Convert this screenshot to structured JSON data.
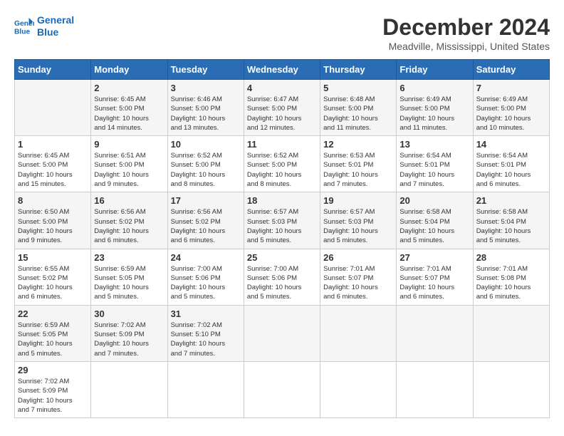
{
  "header": {
    "logo_line1": "General",
    "logo_line2": "Blue",
    "month_title": "December 2024",
    "location": "Meadville, Mississippi, United States"
  },
  "calendar": {
    "days_of_week": [
      "Sunday",
      "Monday",
      "Tuesday",
      "Wednesday",
      "Thursday",
      "Friday",
      "Saturday"
    ],
    "weeks": [
      [
        {
          "day": "",
          "info": ""
        },
        {
          "day": "2",
          "info": "Sunrise: 6:45 AM\nSunset: 5:00 PM\nDaylight: 10 hours\nand 14 minutes."
        },
        {
          "day": "3",
          "info": "Sunrise: 6:46 AM\nSunset: 5:00 PM\nDaylight: 10 hours\nand 13 minutes."
        },
        {
          "day": "4",
          "info": "Sunrise: 6:47 AM\nSunset: 5:00 PM\nDaylight: 10 hours\nand 12 minutes."
        },
        {
          "day": "5",
          "info": "Sunrise: 6:48 AM\nSunset: 5:00 PM\nDaylight: 10 hours\nand 11 minutes."
        },
        {
          "day": "6",
          "info": "Sunrise: 6:49 AM\nSunset: 5:00 PM\nDaylight: 10 hours\nand 11 minutes."
        },
        {
          "day": "7",
          "info": "Sunrise: 6:49 AM\nSunset: 5:00 PM\nDaylight: 10 hours\nand 10 minutes."
        }
      ],
      [
        {
          "day": "1",
          "info": "Sunrise: 6:45 AM\nSunset: 5:00 PM\nDaylight: 10 hours\nand 15 minutes."
        },
        {
          "day": "9",
          "info": "Sunrise: 6:51 AM\nSunset: 5:00 PM\nDaylight: 10 hours\nand 9 minutes."
        },
        {
          "day": "10",
          "info": "Sunrise: 6:52 AM\nSunset: 5:00 PM\nDaylight: 10 hours\nand 8 minutes."
        },
        {
          "day": "11",
          "info": "Sunrise: 6:52 AM\nSunset: 5:00 PM\nDaylight: 10 hours\nand 8 minutes."
        },
        {
          "day": "12",
          "info": "Sunrise: 6:53 AM\nSunset: 5:01 PM\nDaylight: 10 hours\nand 7 minutes."
        },
        {
          "day": "13",
          "info": "Sunrise: 6:54 AM\nSunset: 5:01 PM\nDaylight: 10 hours\nand 7 minutes."
        },
        {
          "day": "14",
          "info": "Sunrise: 6:54 AM\nSunset: 5:01 PM\nDaylight: 10 hours\nand 6 minutes."
        }
      ],
      [
        {
          "day": "8",
          "info": "Sunrise: 6:50 AM\nSunset: 5:00 PM\nDaylight: 10 hours\nand 9 minutes."
        },
        {
          "day": "16",
          "info": "Sunrise: 6:56 AM\nSunset: 5:02 PM\nDaylight: 10 hours\nand 6 minutes."
        },
        {
          "day": "17",
          "info": "Sunrise: 6:56 AM\nSunset: 5:02 PM\nDaylight: 10 hours\nand 6 minutes."
        },
        {
          "day": "18",
          "info": "Sunrise: 6:57 AM\nSunset: 5:03 PM\nDaylight: 10 hours\nand 5 minutes."
        },
        {
          "day": "19",
          "info": "Sunrise: 6:57 AM\nSunset: 5:03 PM\nDaylight: 10 hours\nand 5 minutes."
        },
        {
          "day": "20",
          "info": "Sunrise: 6:58 AM\nSunset: 5:04 PM\nDaylight: 10 hours\nand 5 minutes."
        },
        {
          "day": "21",
          "info": "Sunrise: 6:58 AM\nSunset: 5:04 PM\nDaylight: 10 hours\nand 5 minutes."
        }
      ],
      [
        {
          "day": "15",
          "info": "Sunrise: 6:55 AM\nSunset: 5:02 PM\nDaylight: 10 hours\nand 6 minutes."
        },
        {
          "day": "23",
          "info": "Sunrise: 6:59 AM\nSunset: 5:05 PM\nDaylight: 10 hours\nand 5 minutes."
        },
        {
          "day": "24",
          "info": "Sunrise: 7:00 AM\nSunset: 5:06 PM\nDaylight: 10 hours\nand 5 minutes."
        },
        {
          "day": "25",
          "info": "Sunrise: 7:00 AM\nSunset: 5:06 PM\nDaylight: 10 hours\nand 5 minutes."
        },
        {
          "day": "26",
          "info": "Sunrise: 7:01 AM\nSunset: 5:07 PM\nDaylight: 10 hours\nand 6 minutes."
        },
        {
          "day": "27",
          "info": "Sunrise: 7:01 AM\nSunset: 5:07 PM\nDaylight: 10 hours\nand 6 minutes."
        },
        {
          "day": "28",
          "info": "Sunrise: 7:01 AM\nSunset: 5:08 PM\nDaylight: 10 hours\nand 6 minutes."
        }
      ],
      [
        {
          "day": "22",
          "info": "Sunrise: 6:59 AM\nSunset: 5:05 PM\nDaylight: 10 hours\nand 5 minutes."
        },
        {
          "day": "30",
          "info": "Sunrise: 7:02 AM\nSunset: 5:09 PM\nDaylight: 10 hours\nand 7 minutes."
        },
        {
          "day": "31",
          "info": "Sunrise: 7:02 AM\nSunset: 5:10 PM\nDaylight: 10 hours\nand 7 minutes."
        },
        {
          "day": "",
          "info": ""
        },
        {
          "day": "",
          "info": ""
        },
        {
          "day": "",
          "info": ""
        },
        {
          "day": "",
          "info": ""
        }
      ],
      [
        {
          "day": "29",
          "info": "Sunrise: 7:02 AM\nSunset: 5:09 PM\nDaylight: 10 hours\nand 7 minutes."
        },
        {
          "day": "",
          "info": ""
        },
        {
          "day": "",
          "info": ""
        },
        {
          "day": "",
          "info": ""
        },
        {
          "day": "",
          "info": ""
        },
        {
          "day": "",
          "info": ""
        },
        {
          "day": "",
          "info": ""
        }
      ]
    ]
  }
}
